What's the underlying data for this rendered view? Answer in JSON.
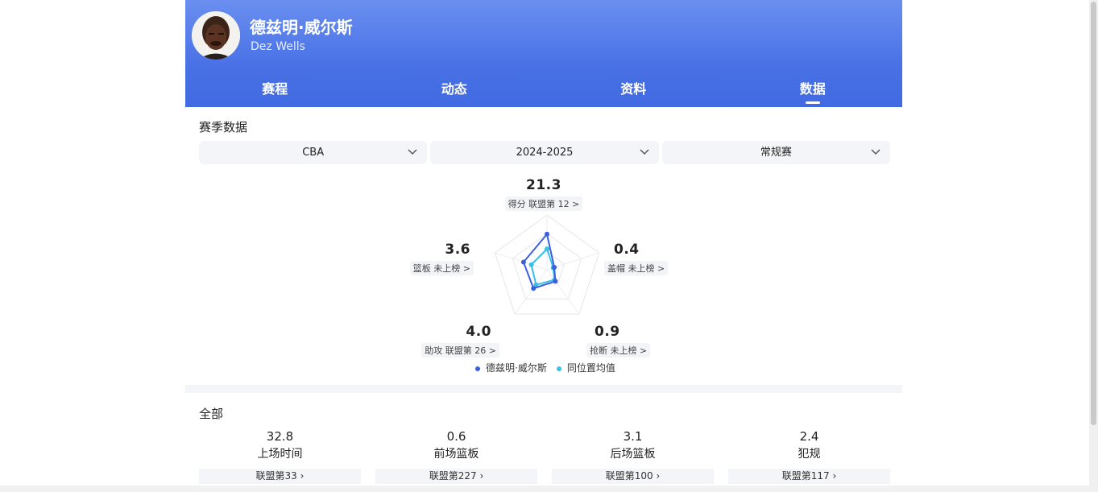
{
  "player": {
    "name_cn": "德兹明·威尔斯",
    "name_en": "Dez Wells"
  },
  "tabs": [
    {
      "label": "赛程"
    },
    {
      "label": "动态"
    },
    {
      "label": "资料"
    },
    {
      "label": "数据",
      "active": true
    }
  ],
  "season_section": {
    "title": "赛季数据",
    "filters": [
      {
        "value": "CBA"
      },
      {
        "value": "2024-2025"
      },
      {
        "value": "常规赛"
      }
    ]
  },
  "chart_data": {
    "type": "radar",
    "axes": [
      {
        "name": "得分",
        "value": "21.3",
        "rank_text": "联盟第 12 >"
      },
      {
        "name": "盖帽",
        "value": "0.4",
        "rank_text": "未上榜 >"
      },
      {
        "name": "抢断",
        "value": "0.9",
        "rank_text": "未上榜 >"
      },
      {
        "name": "助攻",
        "value": "4.0",
        "rank_text": "联盟第 26 >"
      },
      {
        "name": "篮板",
        "value": "3.6",
        "rank_text": "未上榜 >"
      }
    ],
    "series": [
      {
        "name": "德兹明·威尔斯",
        "color": "#3a5fe0",
        "values": [
          0.65,
          0.14,
          0.26,
          0.42,
          0.45
        ]
      },
      {
        "name": "同位置均值",
        "color": "#38c0e6",
        "values": [
          0.38,
          0.12,
          0.23,
          0.34,
          0.3
        ]
      }
    ]
  },
  "all_section": {
    "title": "全部",
    "stats": [
      {
        "value": "32.8",
        "label": "上场时间",
        "rank": "联盟第33"
      },
      {
        "value": "0.6",
        "label": "前场篮板",
        "rank": "联盟第227"
      },
      {
        "value": "3.1",
        "label": "后场篮板",
        "rank": "联盟第100"
      },
      {
        "value": "2.4",
        "label": "犯规",
        "rank": "联盟第117"
      }
    ]
  },
  "colors": {
    "header_blue": "#4a72e6",
    "player_series": "#3a5fe0",
    "average_series": "#38c0e6"
  }
}
